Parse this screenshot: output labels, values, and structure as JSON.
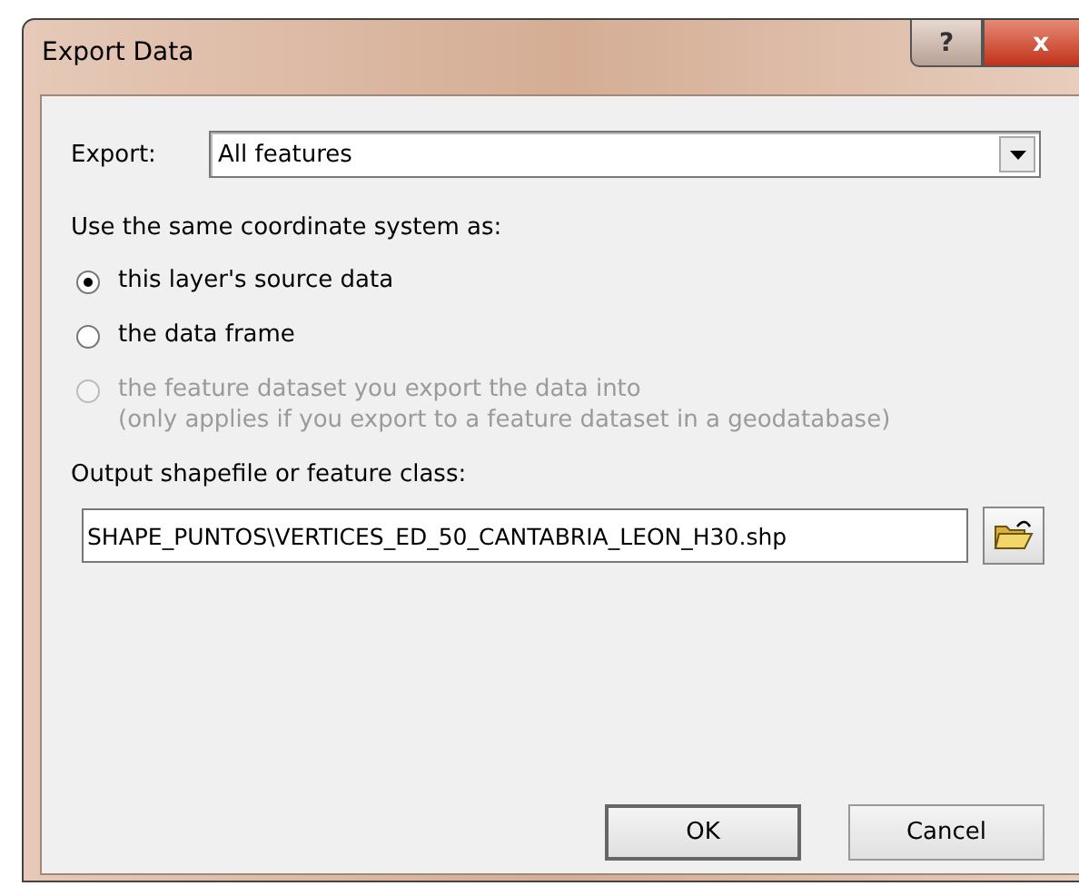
{
  "window": {
    "title": "Export Data",
    "controls": [
      {
        "kind": "help",
        "label": "?"
      },
      {
        "kind": "close",
        "label": "x"
      }
    ]
  },
  "export": {
    "label": "Export:",
    "value": "All features"
  },
  "coordinate_system": {
    "label": "Use the same coordinate system as:",
    "options": [
      {
        "label": "this layer's source data",
        "selected": true,
        "disabled": false
      },
      {
        "label": "the data frame",
        "selected": false,
        "disabled": false
      },
      {
        "label": "the feature dataset you export the data into",
        "note": "(only applies if you export to a feature dataset in a geodatabase)",
        "selected": false,
        "disabled": true
      }
    ]
  },
  "output": {
    "label": "Output shapefile or feature class:",
    "value": "SHAPE_PUNTOS\\VERTICES_ED_50_CANTABRIA_LEON_H30.shp"
  },
  "buttons": [
    {
      "label": "OK",
      "default": true
    },
    {
      "label": "Cancel",
      "default": false
    }
  ]
}
